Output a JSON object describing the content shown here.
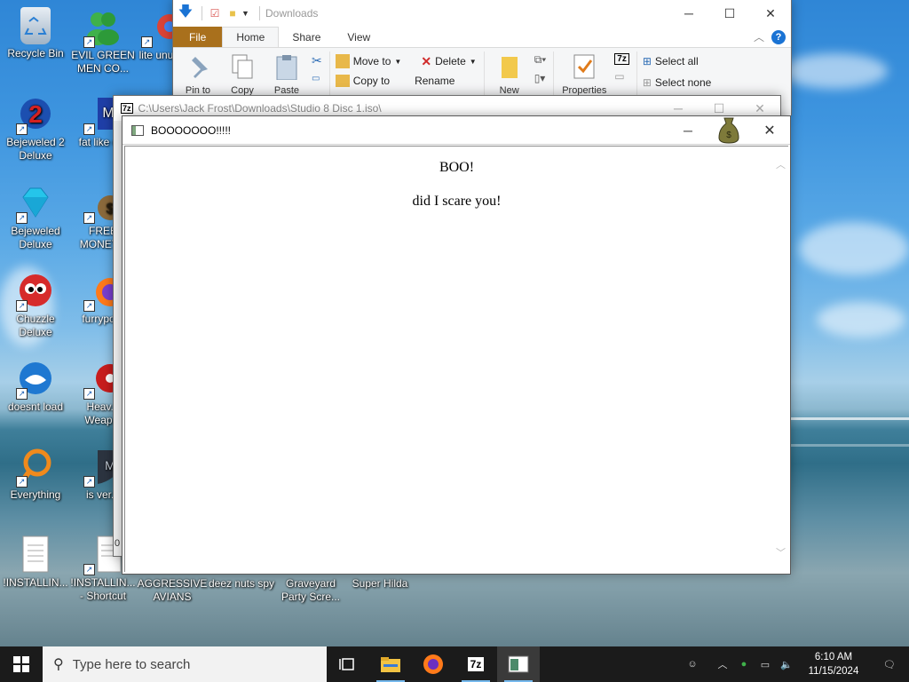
{
  "desktop": {
    "icons": [
      {
        "label": "Recycle Bin"
      },
      {
        "label": "EVIL GREEN MEN CO..."
      },
      {
        "label": "lite unu..."
      },
      {
        "label": "Bejeweled 2 Deluxe"
      },
      {
        "label": "fat like d..."
      },
      {
        "label": "Bejeweled Deluxe"
      },
      {
        "label": "FREE MONEY..."
      },
      {
        "label": "Chuzzle Deluxe"
      },
      {
        "label": "furrypo..."
      },
      {
        "label": "doesnt load"
      },
      {
        "label": "Heav... Weap..."
      },
      {
        "label": "Everything"
      },
      {
        "label": "is ver..."
      },
      {
        "label": "!INSTALLIN..."
      },
      {
        "label": "!INSTALLIN... - Shortcut"
      },
      {
        "label": "AGGRESSIVE AVIANS"
      },
      {
        "label": "deez nuts spy"
      },
      {
        "label": "Graveyard Party Scre..."
      },
      {
        "label": "Super Hilda"
      }
    ]
  },
  "explorer": {
    "title": "Downloads",
    "tabs": [
      "File",
      "Home",
      "Share",
      "View"
    ],
    "ribbon": {
      "pin": "Pin to Quick",
      "copy": "Copy",
      "paste": "Paste",
      "move_to": "Move to",
      "delete": "Delete",
      "copy_to": "Copy to",
      "rename": "Rename",
      "new": "New",
      "properties": "Properties",
      "select_all": "Select all",
      "select_none": "Select none"
    },
    "status_count": "0"
  },
  "sevenzip": {
    "title": "C:\\Users\\Jack Frost\\Downloads\\Studio 8 Disc 1.iso\\"
  },
  "boo": {
    "title": "BOOOOOOO!!!!!",
    "line1": "BOO!",
    "line2": "did I scare you!"
  },
  "taskbar": {
    "search_placeholder": "Type here to search",
    "time": "6:10 AM",
    "date": "11/15/2024"
  },
  "colors": {
    "file_tab": "#a9701c",
    "taskbar": "#1b1b1b",
    "accent": "#0078d7"
  }
}
